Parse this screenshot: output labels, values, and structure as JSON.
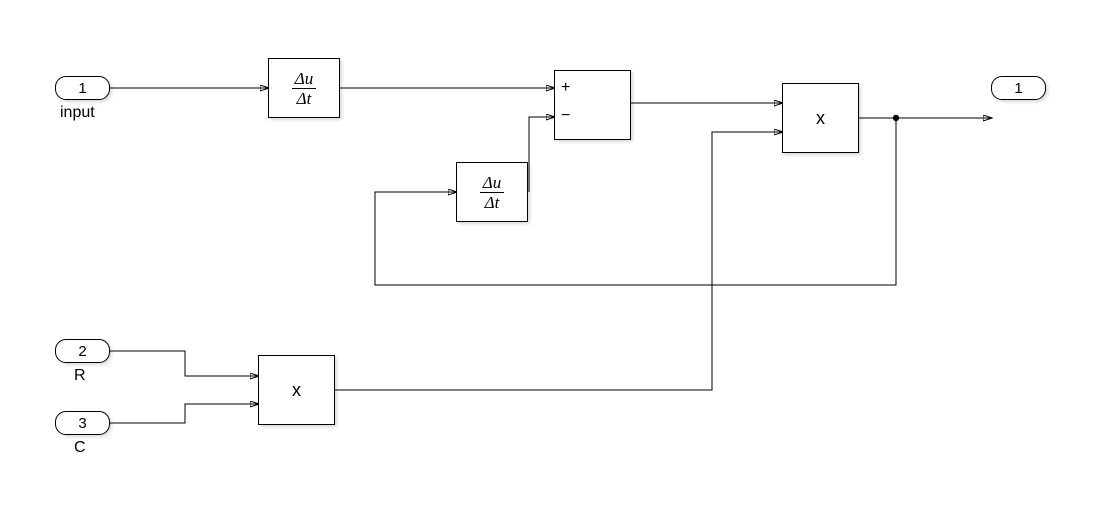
{
  "ports": {
    "in1": {
      "number": "1",
      "label": "input"
    },
    "in2": {
      "number": "2",
      "label": "R"
    },
    "in3": {
      "number": "3",
      "label": "C"
    },
    "out1": {
      "number": "1",
      "label": ""
    }
  },
  "blocks": {
    "deriv1": {
      "numer": "Δu",
      "denom": "Δt"
    },
    "deriv2": {
      "numer": "Δu",
      "denom": "Δt"
    },
    "sum": {
      "sign_top": "+",
      "sign_bot": "−"
    },
    "mult1": {
      "symbol": "x"
    },
    "mult2": {
      "symbol": "x"
    }
  }
}
